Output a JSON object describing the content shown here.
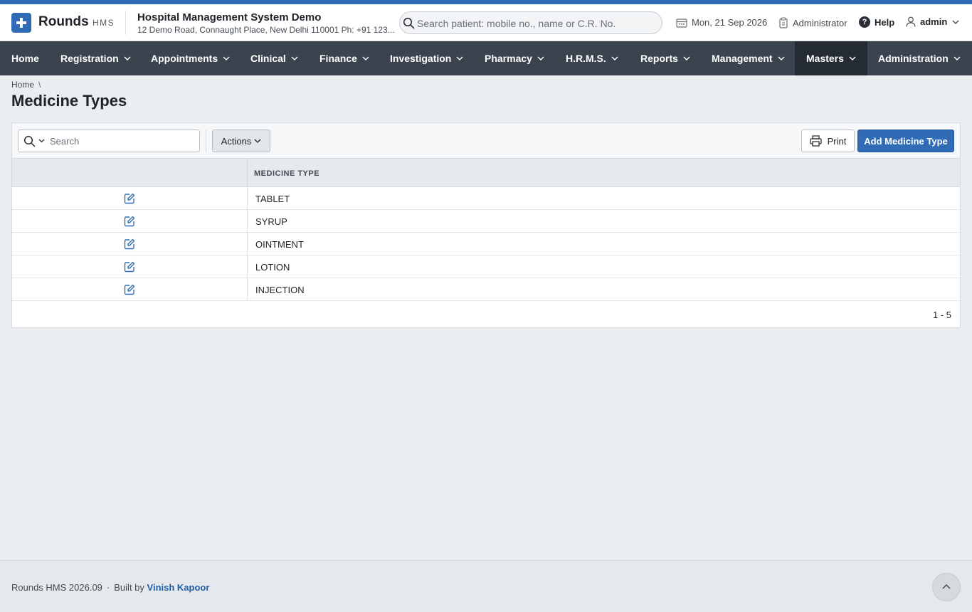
{
  "brand": {
    "name": "Rounds",
    "suffix": "HMS"
  },
  "org": {
    "name": "Hospital Management System Demo",
    "address": "12 Demo Road, Connaught Place, New Delhi 110001 Ph: +91 123..."
  },
  "patient_search": {
    "placeholder": "Search patient: mobile no., name or C.R. No.",
    "value": ""
  },
  "header": {
    "date": "Mon, 21 Sep 2026",
    "role": "Administrator",
    "help": "Help",
    "user": "admin"
  },
  "nav": [
    {
      "label": "Home",
      "dropdown": false,
      "active": false
    },
    {
      "label": "Registration",
      "dropdown": true,
      "active": false
    },
    {
      "label": "Appointments",
      "dropdown": true,
      "active": false
    },
    {
      "label": "Clinical",
      "dropdown": true,
      "active": false
    },
    {
      "label": "Finance",
      "dropdown": true,
      "active": false
    },
    {
      "label": "Investigation",
      "dropdown": true,
      "active": false
    },
    {
      "label": "Pharmacy",
      "dropdown": true,
      "active": false
    },
    {
      "label": "H.R.M.S.",
      "dropdown": true,
      "active": false
    },
    {
      "label": "Reports",
      "dropdown": true,
      "active": false
    },
    {
      "label": "Management",
      "dropdown": true,
      "active": false
    },
    {
      "label": "Masters",
      "dropdown": true,
      "active": true
    },
    {
      "label": "Administration",
      "dropdown": true,
      "active": false
    }
  ],
  "breadcrumb": {
    "home": "Home",
    "separator": "\\"
  },
  "page": {
    "title": "Medicine Types"
  },
  "toolbar": {
    "search_placeholder": "Search",
    "actions_label": "Actions",
    "print_label": "Print",
    "add_label": "Add Medicine Type"
  },
  "table": {
    "header": "MEDICINE TYPE",
    "rows": [
      "TABLET",
      "SYRUP",
      "OINTMENT",
      "LOTION",
      "INJECTION"
    ],
    "pagination": "1 - 5"
  },
  "footer": {
    "product": "Rounds HMS 2026.09",
    "separator": "·",
    "built_by": "Built by",
    "author": "Vinish Kapoor"
  },
  "colors": {
    "brand": "#2f6cb5",
    "nav_bg": "#3b444e",
    "nav_active": "#252b32",
    "page_bg": "#ebeef1"
  }
}
